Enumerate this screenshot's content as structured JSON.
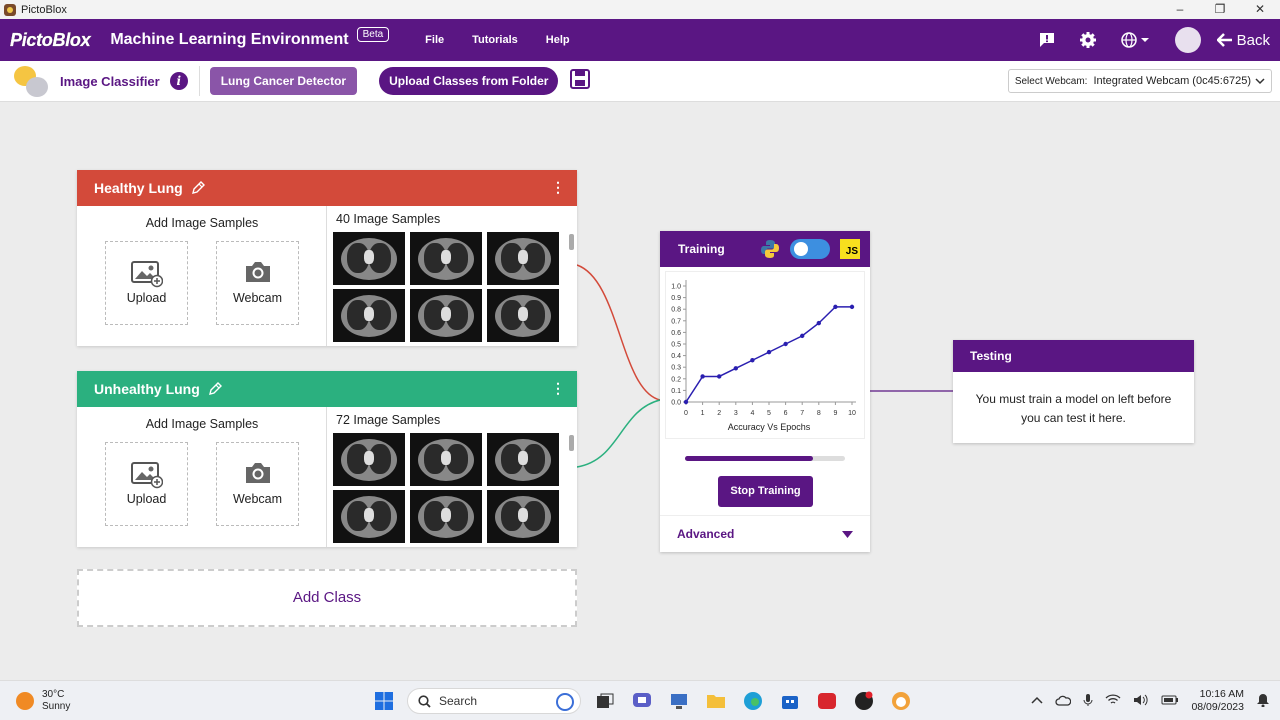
{
  "window": {
    "title": "PictoBlox",
    "controls": {
      "minimize": "–",
      "restore": "❐",
      "close": "✕"
    }
  },
  "header": {
    "logo": "PictoBlox",
    "title": "Machine Learning Environment",
    "badge": "Beta",
    "menu": [
      "File",
      "Tutorials",
      "Help"
    ],
    "back_label": "Back"
  },
  "toolbar": {
    "title": "Image Classifier",
    "info_glyph": "i",
    "project_name": "Lung Cancer Detector",
    "upload_label": "Upload Classes from Folder",
    "webcam_label": "Select Webcam:",
    "webcam_value": "Integrated Webcam (0c45:6725)"
  },
  "classes": [
    {
      "name": "Healthy Lung",
      "color": "#d34a3a",
      "add_title": "Add Image Samples",
      "upload_label": "Upload",
      "webcam_label": "Webcam",
      "sample_count": "40 Image Samples"
    },
    {
      "name": "Unhealthy Lung",
      "color": "#2bb07f",
      "add_title": "Add Image Samples",
      "upload_label": "Upload",
      "webcam_label": "Webcam",
      "sample_count": "72 Image Samples"
    }
  ],
  "add_class_label": "Add Class",
  "training": {
    "title": "Training",
    "js_label": "JS",
    "stop_label": "Stop Training",
    "advanced_label": "Advanced",
    "progress": 0.8
  },
  "chart_data": {
    "type": "line",
    "xlabel": "Accuracy Vs Epochs",
    "x": [
      0,
      1,
      2,
      3,
      4,
      5,
      6,
      7,
      8,
      9,
      10
    ],
    "values": [
      0.0,
      0.22,
      0.22,
      0.29,
      0.36,
      0.43,
      0.5,
      0.57,
      0.68,
      0.82,
      0.82
    ],
    "xticks": [
      "0",
      "1",
      "2",
      "3",
      "4",
      "5",
      "6",
      "7",
      "8",
      "9",
      "10"
    ],
    "yticks": [
      "0.0",
      "0.1",
      "0.2",
      "0.3",
      "0.4",
      "0.5",
      "0.6",
      "0.7",
      "0.8",
      "0.9",
      "1.0"
    ],
    "ylim": [
      0,
      1
    ],
    "xlim": [
      0,
      10
    ],
    "color": "#2a1fb0"
  },
  "testing": {
    "title": "Testing",
    "message": "You must train a model on left before you can test it here."
  },
  "taskbar": {
    "temperature": "30°C",
    "condition": "Sunny",
    "search_placeholder": "Search",
    "time": "10:16 AM",
    "date": "08/09/2023"
  }
}
